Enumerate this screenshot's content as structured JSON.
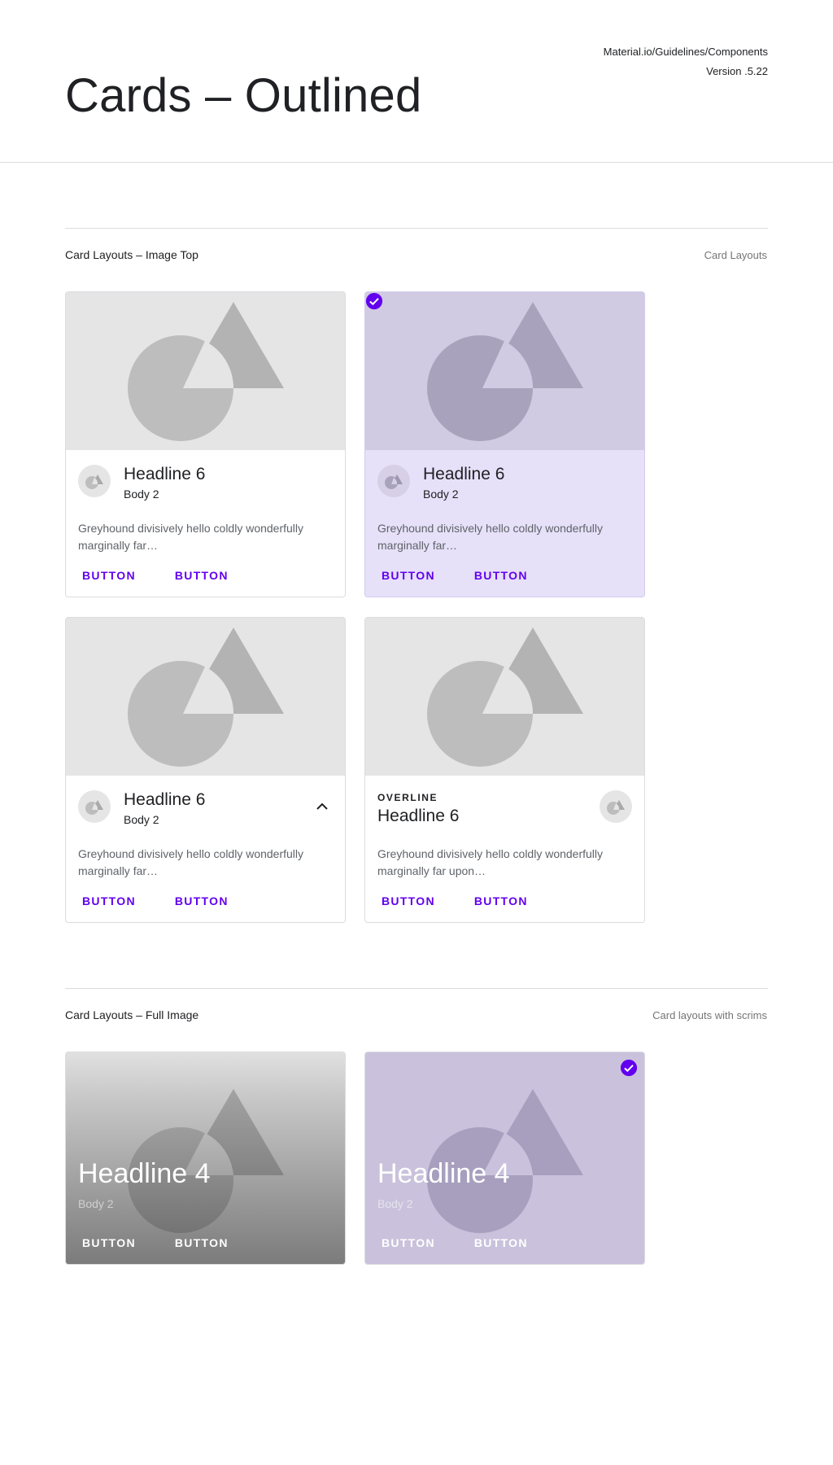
{
  "header": {
    "title": "Cards – Outlined",
    "meta_line1": "Material.io/Guidelines/Components",
    "meta_line2": "Version .5.22"
  },
  "sections": [
    {
      "title": "Card Layouts – Image Top",
      "note": "Card Layouts"
    },
    {
      "title": "Card Layouts – Full Image",
      "note": "Card layouts with scrims"
    }
  ],
  "cards": [
    {
      "headline": "Headline 6",
      "body": "Body 2",
      "supporting": "Greyhound divisively hello coldly wonderfully marginally far…",
      "actions": [
        "BUTTON",
        "BUTTON"
      ]
    },
    {
      "headline": "Headline 6",
      "body": "Body 2",
      "supporting": "Greyhound divisively hello coldly wonderfully marginally far…",
      "actions": [
        "BUTTON",
        "BUTTON"
      ],
      "selected": true
    },
    {
      "headline": "Headline 6",
      "body": "Body 2",
      "supporting": "Greyhound divisively hello coldly wonderfully marginally far…",
      "actions": [
        "BUTTON",
        "BUTTON"
      ]
    },
    {
      "overline": "OVERLINE",
      "headline": "Headline 6",
      "supporting": "Greyhound divisively hello coldly wonderfully marginally far upon…",
      "actions": [
        "BUTTON",
        "BUTTON"
      ]
    }
  ],
  "full_cards": [
    {
      "headline": "Headline 4",
      "body": "Body 2",
      "actions": [
        "BUTTON",
        "BUTTON"
      ]
    },
    {
      "headline": "Headline 4",
      "body": "Body 2",
      "actions": [
        "BUTTON",
        "BUTTON"
      ],
      "selected": true
    }
  ],
  "colors": {
    "accent": "#6200ee",
    "selected_surface": "#e6e0f9",
    "placeholder": "#e5e5e5",
    "shape": "#bdbdbd"
  },
  "icons": {
    "check": "check-circle-icon",
    "expand": "chevron-up-icon",
    "media": "shapes-placeholder-icon"
  }
}
